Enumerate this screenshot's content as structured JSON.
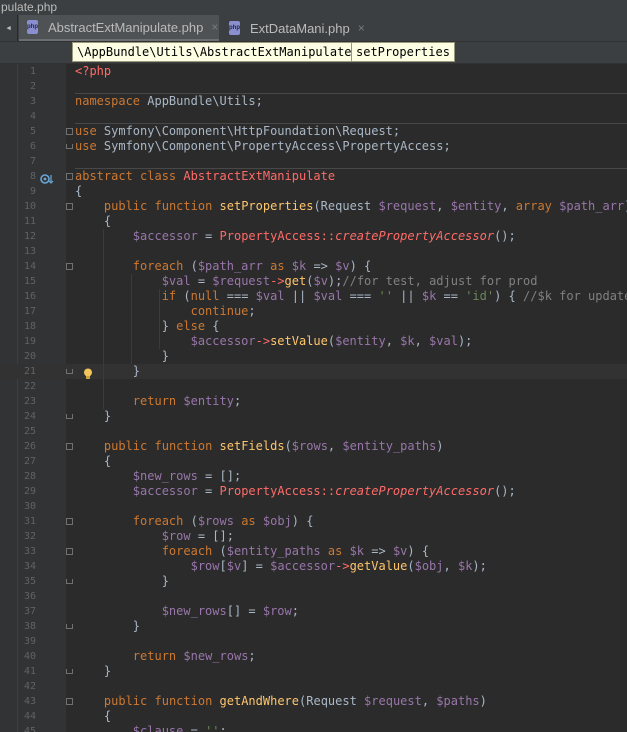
{
  "window": {
    "title_fragment": "pulate.php"
  },
  "tabs": [
    {
      "label": "AbstractExtManipulate.php",
      "active": true,
      "close": "×"
    },
    {
      "label": "ExtDataMani.php",
      "active": false,
      "close": "×"
    }
  ],
  "breadcrumb": {
    "namespace": "\\AppBundle\\Utils\\AbstractExtManipulate",
    "method": "setProperties"
  },
  "icons": {
    "file_type": "php-file-icon",
    "gutter_marker": "implement-method-icon",
    "intention": "lightbulb-icon"
  },
  "colors": {
    "background": "#2b2b2b",
    "keyword": "#cc7832",
    "variable": "#9876aa",
    "function": "#ffc66d",
    "static_call": "#ff6b68",
    "string": "#6a8759",
    "comment": "#808080"
  },
  "code": {
    "line_numbers": [
      "1",
      "2",
      "3",
      "4",
      "5",
      "6",
      "7",
      "8",
      "9",
      "10",
      "11",
      "12",
      "13",
      "14",
      "15",
      "16",
      "17",
      "18",
      "19",
      "20",
      "21",
      "22",
      "23",
      "24",
      "25",
      "26",
      "27",
      "28",
      "29",
      "30",
      "31",
      "32",
      "33",
      "34",
      "35",
      "36",
      "37",
      "38",
      "39",
      "40",
      "41",
      "42",
      "43",
      "44",
      "45"
    ],
    "current_line": 21,
    "lines": [
      "<?php",
      "",
      "namespace AppBundle\\Utils;",
      "",
      "use Symfony\\Component\\HttpFoundation\\Request;",
      "use Symfony\\Component\\PropertyAccess\\PropertyAccess;",
      "",
      "abstract class AbstractExtManipulate",
      "{",
      "    public function setProperties(Request $request, $entity, array $path_arr)",
      "    {",
      "        $accessor = PropertyAccess::createPropertyAccessor();",
      "",
      "        foreach ($path_arr as $k => $v) {",
      "            $val = $request->get($v);//for test, adjust for prod",
      "            if (null === $val || $val === '' || $k == 'id') { //$k for update",
      "                continue;",
      "            } else {",
      "                $accessor->setValue($entity, $k, $val);",
      "            }",
      "        }",
      "",
      "        return $entity;",
      "    }",
      "",
      "    public function setFields($rows, $entity_paths)",
      "    {",
      "        $new_rows = [];",
      "        $accessor = PropertyAccess::createPropertyAccessor();",
      "",
      "        foreach ($rows as $obj) {",
      "            $row = [];",
      "            foreach ($entity_paths as $k => $v) {",
      "                $row[$v] = $accessor->getValue($obj, $k);",
      "            }",
      "",
      "            $new_rows[] = $row;",
      "        }",
      "",
      "        return $new_rows;",
      "    }",
      "",
      "    public function getAndWhere(Request $request, $paths)",
      "    {",
      "        $clause = '';"
    ]
  }
}
